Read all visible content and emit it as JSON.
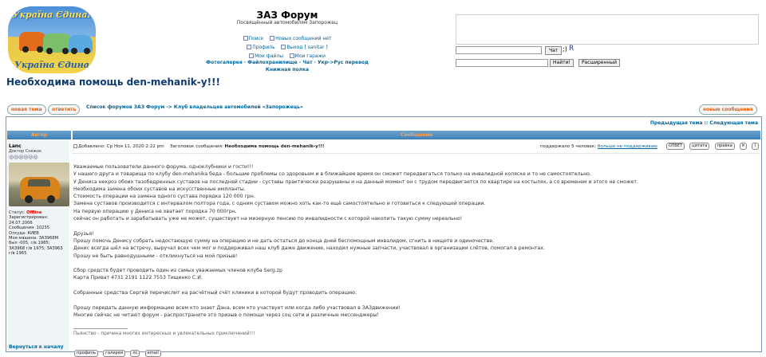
{
  "header": {
    "logo_text_top": "Україна Єдина!",
    "logo_text_bottom": "Україна Єдина",
    "site_title": "ЗАЗ Форум",
    "site_description": "Посвящённый автомобилям Запорожец",
    "links_row1": [
      "Поиск",
      "Новых сообщений нет"
    ],
    "links_row2": [
      "Профиль",
      "Выход [ sanitar ]"
    ],
    "links_row3": [
      "Мои файлы",
      "Мои гаражи"
    ],
    "bold_links_line1": "Фотогалерея · Файлохранилище · Чат · Укр->Рус перевод",
    "bold_links_line2": "Книжная полка"
  },
  "chat": {
    "input_value": "",
    "button_label": "Чат",
    "smiley": ";)",
    "r_label": "R"
  },
  "search": {
    "input_value": "",
    "button_label": "Найти!",
    "advanced_label": "Расширенный"
  },
  "topic": {
    "title": "Необходима помощь den-mehanik-y!!!",
    "new_topic_label": "новая тема",
    "reply_label": "ответить",
    "breadcrumb": "Список форумов ЗАЗ Форум -> Клуб владельцев автомобилей «Запорожець»",
    "new_posts_label": "новые сообщения",
    "prev_next": "Предыдущая тема :: Следующая тема"
  },
  "table": {
    "col_author": "Автор",
    "col_message": "Сообщение"
  },
  "post": {
    "author": "Lanc",
    "rank": "Доктор Снежок",
    "stars": "◎◎◎◎◎◎",
    "user_info": [
      [
        "Статус: ",
        "Offline"
      ],
      [
        "Зарегистрирован: ",
        ""
      ],
      [
        "24.07.2006",
        ""
      ],
      [
        "Сообщения: 10235",
        ""
      ],
      [
        "Откуда: КИЕВ",
        ""
      ],
      [
        "Моя машина: ЗАЗ968М",
        ""
      ],
      [
        "был -005, г/в 1985;",
        ""
      ],
      [
        "ЗАЗ968 г/в 1975; ЗАЗ963",
        ""
      ],
      [
        "г/в 1965",
        ""
      ]
    ],
    "meta_added": "Добавлено: Ср Ноя 11, 2020 2:22 pm",
    "meta_subject_label": "Заголовок сообщения:",
    "meta_subject": "Необходима помощь den-mehanik-y!!!",
    "thanks_prefix": "поддержало 5 человек:",
    "thanks_link": "больше не поддерживаю",
    "buttons": [
      "ОТВЕТ",
      "цитата",
      "правка",
      "✕",
      "i"
    ],
    "body": [
      "Уважаемые пользователи данного форума, одноклубники и гости!!!",
      "У нашего друга и товарища по клубу den-mehanika беда - большие проблемы со здоровьем и в ближайшее время он сможет передвигаться только на инвалидной коляске и то не самостоятельно.",
      "У Дениса некроз обоих тазобедренных суставов на последней стадии - суставы практически разрушены и на данный момент он с трудом передвигается по квартире на костылях, а со временем и этого не сможет.",
      "Необходима замена обоих суставов на искусственные импланты.",
      "Стоимость операции на замена одного сустава порядка 120 000 грн.",
      "Замена суставов производится с интервалом полтора года, с одним суставом можно хоть как-то ещё самостоятельно и готовиться к следующей операции.",
      "На первую операцию у Дениса не хватает порядка 70 000грн.",
      "сейчас он работать и зарабатывать уже не может, существует на мизерную пенсию по инвалидности с которой накопить такую сумму нереально!",
      "",
      "Друзья!",
      "Прошу помочь Денису собрать недостающую сумму на операцию и не дать остаться до конца дней беспомощным инвалидом, сгнить в нищете и одиночестве.",
      "Денис всегда шёл на встречу, выручал всех чем мог и поддерживал наш клуб даже движение, находил нужные запчасти, участвовал в организации слётов, помогал в ремонтах.",
      "Прошу не быть равнодушными - откликнуться на мой призыв!",
      "",
      "Сбор средств будет проводить один из самых уважаемых членов клуба Serg.zp",
      "Карта Приват 4731 2191 1122 7553 Тищенко С.И.",
      "",
      "Собранные средства Сергей перечислит на расчётный счёт клиники в которой будут проводить операцию.",
      "",
      "Прошу передать данную информацию всем кто знает Дэна, всем кто участвует или когда либо участвовал в ЗАЗдвижении!",
      "Многие сейчас не читают форум - распространите это призыв о помощи через соц сети и различные мессенджеры!"
    ],
    "signature": "Пьянство - причина многих интересных и увлекательных приключений!!!",
    "back_to_top": "Вернуться к началу",
    "user_buttons": [
      "профиль",
      "галерея",
      "лс",
      "email"
    ]
  },
  "colors": {
    "link": "#006699",
    "header_gradient_top": "#6aa3d0",
    "header_text": "#ffa34f",
    "offline": "#dd0000",
    "title": "#0e3c6e"
  }
}
